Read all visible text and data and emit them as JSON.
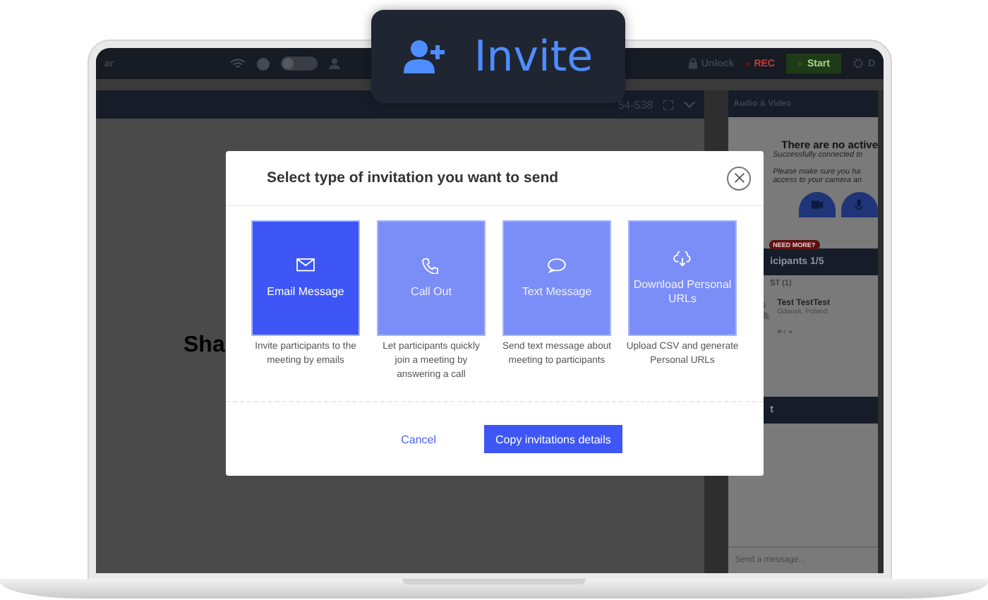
{
  "badge": {
    "label": "Invite"
  },
  "top_bar": {
    "left_label": "ar",
    "toggle": {
      "on": false
    },
    "lock_label": "Unlock",
    "rec_label": "REC",
    "start_label": "Start",
    "settings_label": "D"
  },
  "stage": {
    "meeting_id": "54-538",
    "share_text": "Sha"
  },
  "side_panel": {
    "audio_title": "Audio & Video",
    "heading": "There are no active",
    "lines": [
      "Successfully connected to",
      "Please make sure you ha",
      "access to your camera an"
    ],
    "need_more": "NEED MORE?",
    "participants_title": "icipants 1/5",
    "group": "ST (1)",
    "participant": {
      "name": "Test TestTest",
      "location": "Gdansk, Poland"
    },
    "chat_title": "t",
    "message_placeholder": "Send a message..."
  },
  "dialog": {
    "title": "Select type of invitation you want to send",
    "options": [
      {
        "kind": "email",
        "label": "Email Message",
        "description": "Invite participants to the meeting by emails",
        "selected": true
      },
      {
        "kind": "phone",
        "label": "Call Out",
        "description": "Let participants quickly join a meeting by answering a call",
        "selected": false
      },
      {
        "kind": "chat",
        "label": "Text Message",
        "description": "Send text message about meeting to participants",
        "selected": false
      },
      {
        "kind": "download",
        "label": "Download Personal URLs",
        "description": "Upload CSV and generate Personal URLs",
        "selected": false
      }
    ],
    "buttons": [
      {
        "kind": "link",
        "label": "Cancel"
      },
      {
        "kind": "primary",
        "label": "Copy invitations details"
      }
    ]
  }
}
